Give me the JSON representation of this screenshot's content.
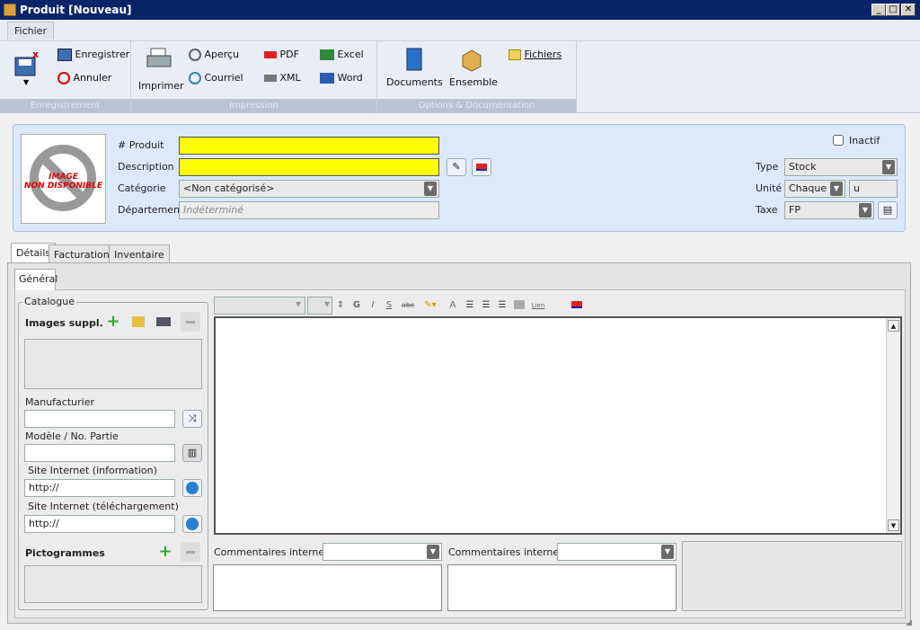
{
  "window": {
    "title": "Produit [Nouveau]",
    "min": "_",
    "max": "□",
    "close": "✕"
  },
  "menu": {
    "fichier": "Fichier"
  },
  "ribbon": {
    "groups": {
      "enregistrement": "Enregistrement",
      "impression": "Impression",
      "options": "Options & Documentation"
    },
    "enregistrer": "Enregistrer",
    "annuler": "Annuler",
    "imprimer": "Imprimer",
    "apercu": "Aperçu",
    "courriel": "Courriel",
    "pdf": "PDF",
    "xml": "XML",
    "excel": "Excel",
    "word": "Word",
    "documents": "Documents",
    "ensemble": "Ensemble",
    "fichiers": "Fichiers"
  },
  "product": {
    "image_text_1": "IMAGE",
    "image_text_2": "NON DISPONIBLE",
    "num_label": "# Produit",
    "num_value": "",
    "desc_label": "Description",
    "desc_value": "",
    "cat_label": "Catégorie",
    "cat_value": "<Non catégorisé>",
    "dept_label": "Département",
    "dept_placeholder": "Indéterminé",
    "inactif_label": "Inactif",
    "type_label": "Type",
    "type_value": "Stock",
    "unite_label": "Unité",
    "unite_value": "Chaque",
    "unite_short": "u",
    "taxe_label": "Taxe",
    "taxe_value": "FP"
  },
  "tabs": [
    "Détails",
    "Facturation",
    "Inventaire"
  ],
  "subtab": "Général",
  "catalog": {
    "title": "Catalogue",
    "images_label": "Images suppl.",
    "manufacturier_label": "Manufacturier",
    "manufacturier_value": "",
    "modele_label": "Modèle / No. Partie",
    "modele_value": "",
    "site_info_label": "Site Internet (information)",
    "site_info_value": "http://",
    "site_dl_label": "Site Internet (téléchargement)",
    "site_dl_value": "http://",
    "picto_label": "Pictogrammes"
  },
  "editor": {
    "toolbar_lien": "Lien",
    "bold": "G",
    "italic": "I",
    "underline": "S",
    "strike": "abc",
    "fontcolor": "A"
  },
  "comments": {
    "label1": "Commentaires internes",
    "label2": "Commentaires internes"
  },
  "colors": {
    "titlebar": "#0a246a",
    "required": "#ffff00",
    "panel": "#dbe9fb"
  }
}
